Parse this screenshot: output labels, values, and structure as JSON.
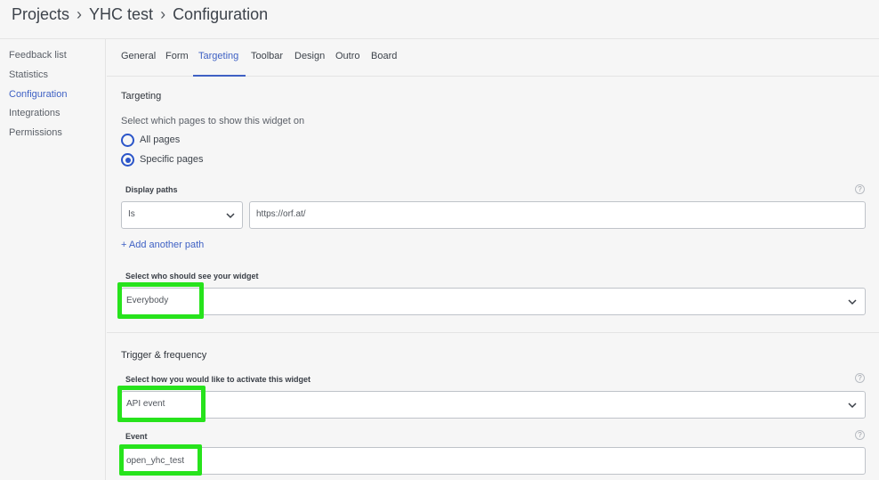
{
  "breadcrumb": {
    "items": [
      "Projects",
      "YHC test",
      "Configuration"
    ],
    "separator": "›"
  },
  "sidebar": {
    "items": [
      {
        "label": "Feedback list"
      },
      {
        "label": "Statistics"
      },
      {
        "label": "Configuration"
      },
      {
        "label": "Integrations"
      },
      {
        "label": "Permissions"
      }
    ],
    "active_index": 2
  },
  "tabs": {
    "items": [
      {
        "label": "General"
      },
      {
        "label": "Form"
      },
      {
        "label": "Targeting"
      },
      {
        "label": "Toolbar"
      },
      {
        "label": "Design"
      },
      {
        "label": "Outro"
      },
      {
        "label": "Board"
      }
    ],
    "active_index": 2
  },
  "targeting": {
    "title": "Targeting",
    "pages_prompt": "Select which pages to show this widget on",
    "options": [
      {
        "label": "All pages",
        "checked": false
      },
      {
        "label": "Specific pages",
        "checked": true
      }
    ],
    "display_paths_label": "Display paths",
    "path_operator": "Is",
    "path_value": "https://orf.at/",
    "add_path": "+ Add another path",
    "audience_label": "Select who should see your widget",
    "audience_value": "Everybody"
  },
  "trigger": {
    "title": "Trigger & frequency",
    "activate_label": "Select how you would like to activate this widget",
    "activate_value": "API event",
    "event_label": "Event",
    "event_value": "open_yhc_test"
  },
  "icons": {
    "help": "question-circle-icon",
    "dropdown": "chevron-down-icon"
  },
  "colors": {
    "accent": "#3f61c4",
    "highlight": "#27e31c"
  }
}
